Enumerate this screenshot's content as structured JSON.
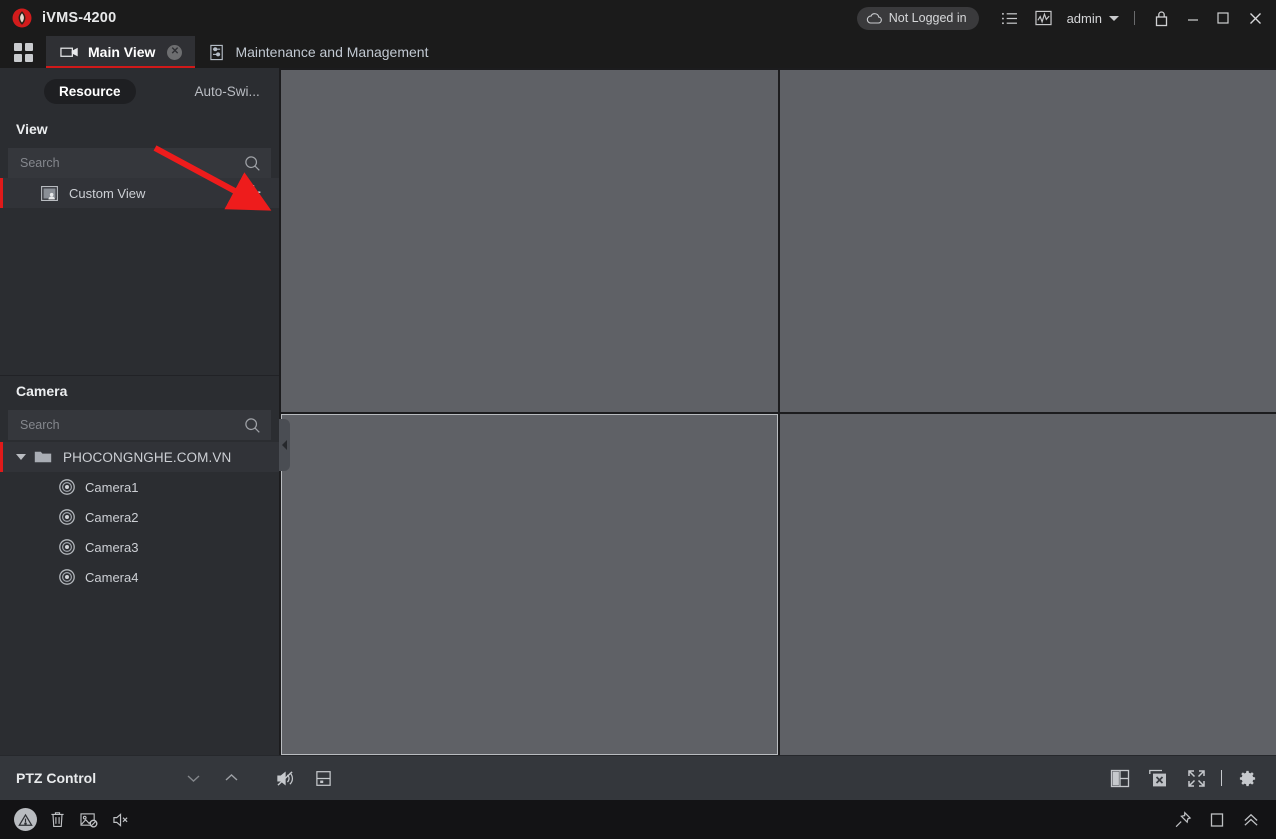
{
  "titlebar": {
    "app_name": "iVMS-4200",
    "logo_icon": "hik-logo-icon",
    "cloud_status": "Not Logged in",
    "cloud_icon": "cloud-icon",
    "list_icon": "task-list-icon",
    "chart_icon": "statistics-chart-icon",
    "user_name": "admin",
    "user_caret_icon": "chevron-down-icon",
    "lock_icon": "lock-icon",
    "minimize_icon": "minimize-icon",
    "maximize_icon": "maximize-icon",
    "close_icon": "close-icon"
  },
  "tabbar": {
    "apps_icon": "apps-grid-icon",
    "tabs": [
      {
        "label": "Main View",
        "icon": "video-camera-icon",
        "active": true,
        "close_icon": "tab-close-icon",
        "close_glyph": "✕"
      },
      {
        "label": "Maintenance and Management",
        "icon": "sliders-icon",
        "active": false
      }
    ]
  },
  "sidebar": {
    "segments": [
      {
        "label": "Resource",
        "active": true
      },
      {
        "label": "Auto-Swi...",
        "active": false
      }
    ],
    "view_panel": {
      "title": "View",
      "search_placeholder": "Search",
      "search_icon": "search-icon",
      "items": [
        {
          "label": "Custom View",
          "icon": "custom-view-icon",
          "selected": true,
          "add_icon": "plus-icon",
          "add_glyph": "＋"
        }
      ]
    },
    "camera_panel": {
      "title": "Camera",
      "search_placeholder": "Search",
      "search_icon": "search-icon",
      "group": {
        "label": "PHOCONGNGHE.COM.VN",
        "folder_icon": "folder-icon",
        "expander_icon": "triangle-down-icon",
        "selected": true,
        "cameras": [
          {
            "label": "Camera1",
            "icon": "camera-lens-icon"
          },
          {
            "label": "Camera2",
            "icon": "camera-lens-icon"
          },
          {
            "label": "Camera3",
            "icon": "camera-lens-icon"
          },
          {
            "label": "Camera4",
            "icon": "camera-lens-icon"
          }
        ]
      }
    },
    "splitter_icon": "collapse-left-icon"
  },
  "viewer": {
    "layout": "2x2",
    "cells": [
      {
        "name": "cell-1",
        "active": false
      },
      {
        "name": "cell-2",
        "active": false
      },
      {
        "name": "cell-3",
        "active": true
      },
      {
        "name": "cell-4",
        "active": false
      }
    ]
  },
  "ptzbar": {
    "title": "PTZ Control",
    "collapse_down_icon": "chevron-down-icon",
    "collapse_up_icon": "chevron-up-icon",
    "mute_icon": "speaker-mute-icon",
    "save_icon": "save-icon",
    "layout_icon": "window-layout-icon",
    "close_window_icon": "close-window-icon",
    "fullscreen_icon": "fullscreen-icon",
    "settings_icon": "gear-icon"
  },
  "statusbar": {
    "alarm_icon": "alarm-warning-icon",
    "trash_icon": "trash-icon",
    "image_off_icon": "image-disabled-icon",
    "sound_off_icon": "sound-off-icon",
    "pin_icon": "pin-icon",
    "window_icon": "window-icon",
    "chevrons_up_icon": "chevrons-up-icon"
  },
  "annotation": {
    "arrow_color": "#ee1c1c",
    "arrow_from": "155,148",
    "arrow_to": "252,201"
  },
  "colors": {
    "accent_red": "#d01919",
    "panel_bg": "#2b2d31",
    "video_cell": "#5f6166",
    "titlebar_bg": "#1b1b1b",
    "statusbar_bg": "#131315"
  }
}
